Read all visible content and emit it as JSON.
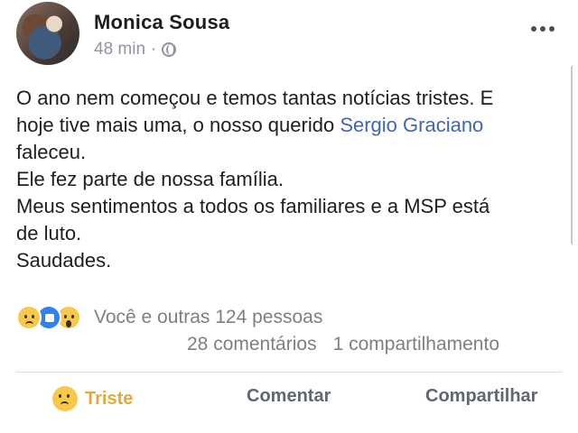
{
  "post": {
    "author": "Monica Sousa",
    "time": "48 min",
    "separator": "·",
    "visibility_icon": "globe-icon",
    "more_icon": "more-options-icon",
    "body": {
      "line1": "O ano nem começou e temos tantas notícias tristes. E",
      "line2_before": "hoje tive mais uma, o nosso querido ",
      "mention": "Sergio Graciano",
      "line3": "faleceu.",
      "line4": "Ele fez parte de nossa família.",
      "line5": "Meus sentimentos a todos os familiares e a MSP está",
      "line6": "de luto.",
      "line7": "Saudades."
    }
  },
  "reactions": {
    "icons": [
      "sad-reaction-icon",
      "like-reaction-icon",
      "wow-reaction-icon"
    ],
    "summary": "Você e outras 124 pessoas"
  },
  "counts": {
    "comments": "28 comentários",
    "shares": "1 compartilhamento"
  },
  "actions": {
    "react_label": "Triste",
    "comment_label": "Comentar",
    "share_label": "Compartilhar"
  },
  "colors": {
    "text": "#1c1e21",
    "meta": "#90949c",
    "mention": "#4267b2",
    "secondary": "#7f7f7f",
    "reaction_active": "#e5a83a",
    "action": "#606770"
  }
}
